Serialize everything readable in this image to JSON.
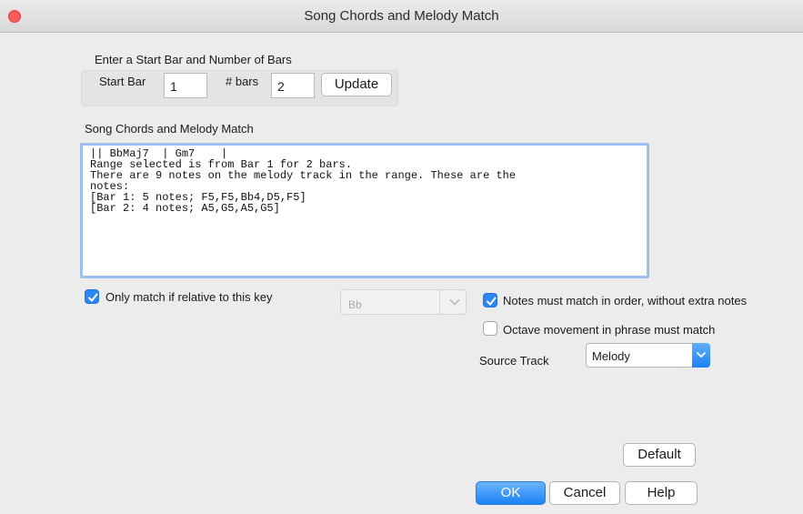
{
  "window": {
    "title": "Song Chords and Melody Match"
  },
  "range": {
    "heading": "Enter a Start Bar and Number of Bars",
    "start_bar_label": "Start Bar",
    "start_bar_value": "1",
    "bars_label": "# bars",
    "bars_value": "2",
    "update_label": "Update"
  },
  "match_section": {
    "label": "Song Chords and Melody Match",
    "lines": [
      "|| BbMaj7  | Gm7    |",
      "Range selected is from Bar 1 for 2 bars.",
      "There are 9 notes on the melody track in the range. These are the",
      "notes:",
      "[Bar 1: 5 notes; F5,F5,Bb4,D5,F5]",
      "[Bar 2: 4 notes; A5,G5,A5,G5]"
    ]
  },
  "options": {
    "key_match_label": "Only match if relative to this  key",
    "key_match_checked": true,
    "key_value": "Bb",
    "order_label": "Notes must match in order, without extra notes",
    "order_checked": true,
    "octave_label": "Octave movement in phrase must match",
    "octave_checked": false,
    "source_track_label": "Source Track",
    "source_track_value": "Melody"
  },
  "buttons": {
    "default": "Default",
    "ok": "OK",
    "cancel": "Cancel",
    "help": "Help"
  },
  "colors": {
    "accent": "#2e86f2",
    "close": "#fc5b57"
  }
}
